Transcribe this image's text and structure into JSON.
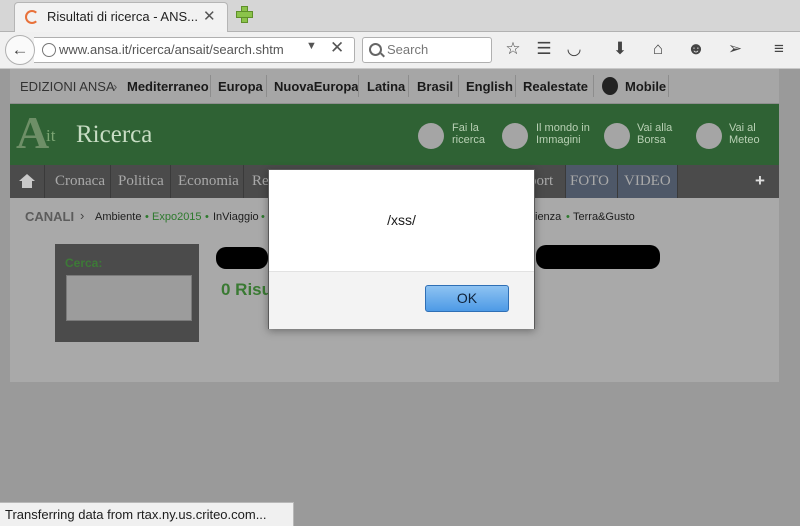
{
  "browser": {
    "tab_title": "Risultati di ricerca - ANS...",
    "url": "www.ansa.it/ricerca/ansait/search.shtm",
    "search_placeholder": "Search",
    "status": "Transferring data from rtax.ny.us.criteo.com..."
  },
  "site": {
    "editions_label": "EDIZIONI ANSA",
    "editions": [
      "Mediterraneo",
      "Europa",
      "NuovaEuropa",
      "Latina",
      "Brasil",
      "English",
      "Realestate",
      "Mobile"
    ],
    "logo_a": "A",
    "logo_it": "it",
    "logo_ricerca": "Ricerca",
    "header_links": [
      {
        "line1": "Fai la",
        "line2": "ricerca"
      },
      {
        "line1": "Il mondo in",
        "line2": "Immagini"
      },
      {
        "line1": "Vai alla",
        "line2": "Borsa"
      },
      {
        "line1": "Vai al",
        "line2": "Meteo"
      }
    ],
    "menu": [
      "Cronaca",
      "Politica",
      "Economia",
      "Re",
      "port",
      "FOTO",
      "VIDEO"
    ],
    "menu_plus": "+",
    "canali_label": "CANALI",
    "canali": [
      "Ambiente",
      "Expo2015",
      "InViaggio",
      "ienza",
      "Terra&Gusto"
    ],
    "cerca_label": "Cerca:",
    "results_count": "0 Risu"
  },
  "dialog": {
    "message": "/xss/",
    "ok_label": "OK"
  },
  "colors": {
    "green_header": "#2f6234",
    "menu_bg": "#4b4b4b",
    "ok_button": "#4d9ae6"
  }
}
